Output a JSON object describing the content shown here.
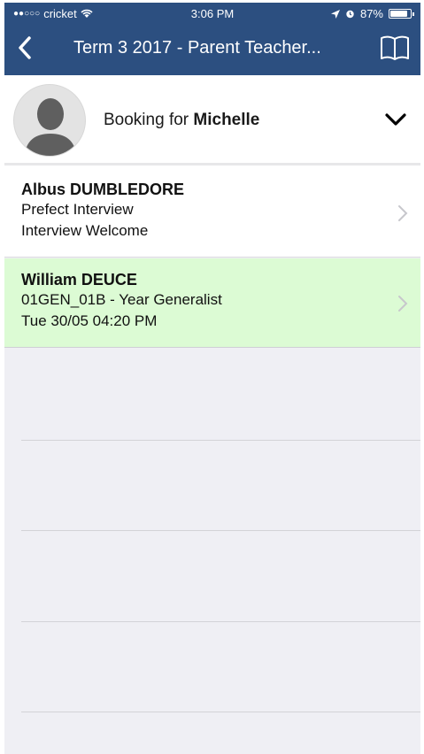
{
  "status_bar": {
    "signal_dots": "●●○○○",
    "carrier": "cricket",
    "time": "3:06 PM",
    "battery": "87%",
    "battery_level": 0.87
  },
  "nav": {
    "title": "Term 3 2017 - Parent Teacher...",
    "back_icon": "chevron-left-icon",
    "book_icon": "book-icon",
    "bar_color": "#2c4f80"
  },
  "booking": {
    "prefix": "Booking for ",
    "student_name": "Michelle"
  },
  "bookings": [
    {
      "name": "Albus DUMBLEDORE",
      "line1": "Prefect Interview",
      "line2": "Interview Welcome",
      "highlight": false
    },
    {
      "name": "William DEUCE",
      "line1": "01GEN_01B - Year  Generalist",
      "line2": "Tue 30/05 04:20 PM",
      "highlight": true,
      "highlight_color": "#dcfbd4"
    }
  ]
}
